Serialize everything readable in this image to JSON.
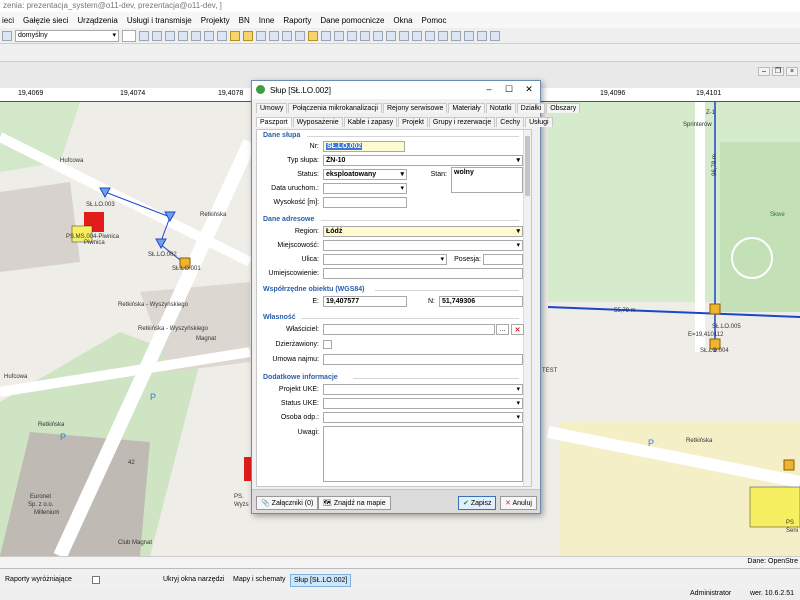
{
  "app": {
    "title": "zenia: prezentacja_system@o11-dev, prezentacja@o11-dev, ]"
  },
  "menu": [
    "ieci",
    "Gałęzie sieci",
    "Urządzenia",
    "Usługi i transmisje",
    "Projekty",
    "BN",
    "Inne",
    "Raporty",
    "Dane pomocnicze",
    "Okna",
    "Pomoc"
  ],
  "toolbar": {
    "style_select": "domyślny"
  },
  "ruler": [
    "19,4069",
    "19,4074",
    "19,4078",
    "19,4096",
    "19,4101"
  ],
  "map": {
    "labels": [
      "Hufcowa",
      "Retkińska",
      "Retkińska",
      "Hufcowa",
      "Sprinterów",
      "Retkińska - Wyszyńskiego",
      "Retkińska - Wyszyńskiego",
      "Magnat",
      "Club Magnat",
      "Euronet",
      "Sp. z o.o.",
      "Millenium",
      "Skwe",
      "SŁ.LO.003",
      "SŁ.LO.002",
      "SŁ.LO.001",
      "PS.MS.004-Piwnica",
      "Piwnica",
      "SŁ.LO.005",
      "SŁ.LO.004",
      "PS.",
      "Wyżs",
      "PS",
      "Seni",
      "55,79 m",
      "96,78 m",
      "E=19,410112",
      "42",
      "Z-1",
      "P",
      "P",
      "P",
      "TEST",
      "Retkińska"
    ],
    "scale_label": "Dane: OpenStre"
  },
  "dialog": {
    "title": "Słup [SŁ.LO.002]",
    "tabs_row1": [
      "Umowy",
      "Połączenia mikrokanalizacji",
      "Rejony serwisowe",
      "Materiały",
      "Notatki",
      "Działki",
      "Obszary"
    ],
    "tabs_row2": [
      "Paszport",
      "Wyposażenie",
      "Kable i zapasy",
      "Projekt",
      "Grupy i rezerwacje",
      "Cechy",
      "Usługi"
    ],
    "sections": {
      "pole": "Dane słupa",
      "address": "Dane adresowe",
      "coords": "Współrzędne obiektu (WGS84)",
      "owner": "Własność",
      "extra": "Dodatkowe informacje"
    },
    "labels": {
      "nr": "Nr:",
      "type": "Typ słupa:",
      "status": "Status:",
      "state": "Stan:",
      "start": "Data uruchom.:",
      "height": "Wysokość [m]:",
      "region": "Region:",
      "town": "Miejscowość:",
      "street": "Ulica:",
      "plot": "Posesja:",
      "place": "Umiejscowienie:",
      "e": "E:",
      "n": "N:",
      "owner": "Właściciel:",
      "lease": "Dzierżawiony:",
      "lease_no": "Umowa najmu:",
      "uke": "Projekt UKE:",
      "uke_status": "Status UKE:",
      "resp": "Osoba odp.:",
      "notes": "Uwagi:"
    },
    "values": {
      "nr": "SŁ.LO.002",
      "type": "ŻN-10",
      "status": "eksploatowany",
      "state": "wolny",
      "region": "Łódź",
      "e": "19,407577",
      "n": "51,749306"
    },
    "buttons": {
      "attachments": "Załączniki (0)",
      "find": "Znajdź na mapie",
      "save": "Zapisz",
      "cancel": "Anuluj"
    }
  },
  "taskbar": {
    "reports": "Raporty wyróżniające",
    "hide": "Ukryj okna narzędzi",
    "maps": "Mapy i schematy",
    "pole": "Słup [SŁ.LO.002]"
  },
  "status": {
    "user": "Administrator",
    "version": "wer. 10.6.2.51"
  }
}
